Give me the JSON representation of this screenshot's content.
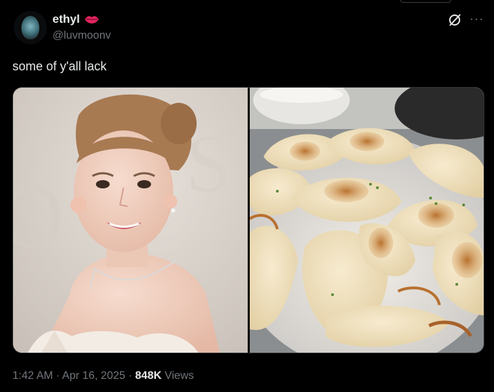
{
  "post": {
    "display_name": "ethyl",
    "handle": "@luvmoonv",
    "text": "some of y'all lack",
    "time": "1:42 AM",
    "date": "Apr 16, 2025",
    "views_count": "848K",
    "views_label": "Views",
    "separator": "·"
  },
  "icons": {
    "badge": "lips-icon",
    "grok": "grok-icon",
    "more": "more-icon"
  },
  "colors": {
    "background": "#000000",
    "text": "#e7e9ea",
    "muted": "#71767b",
    "lips": "#e0245e"
  }
}
